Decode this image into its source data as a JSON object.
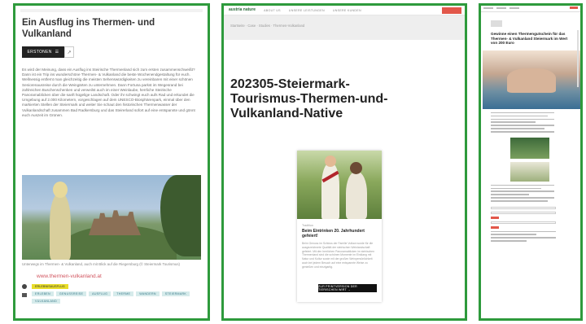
{
  "panel1": {
    "title": "Ein Ausflug ins Thermen- und Vulkanland",
    "tab_label": "ERSTONEN",
    "tab_caret": "☰",
    "tab_second": "↗",
    "body": "Es wird der Meinung, dass ein Ausflug ins Steirische Thermenland sich zum ersten zusammenschweißt? Dann ist ein Trip ins wunderschöne Thermen- & Vulkanland die beste Wochenendgestaltung für euch. Wellnessig entfernt man gleichzeitig die meisten Sehenswürdigkeiten zu vereinbaren mit einer schönen Seniorenausreise durch die Weingärten zu unternehmen. Dann Fortuna parkst im Wegesrand bei zahlreichen Buschenschenken und verweilst auch im einer Weinlaube, herrliche Steirische Panoramablicken über die sanft hügelige Landschaft. Oder ihr schwingt euch aufs Rad und erkundet die Umgebung auf 2.000 Kilometern, vorgeschlagen auf dem UNESCO-Biosphärenpark, einmal über den markierten Stellen der Steiermark und weiter Sie schaut den historischen Thermenwasser der Vulkanlandschaft zusammen Bad Radkersburg und das Steirerland sofort auf eine entspannte und gönnt euch Auszeit im Grünen.",
    "photo_caption": "Unterwegs im Thermen- & Vulkanland, auch mit Blick auf die Riegersburg (© Steiermark Tourismus)",
    "link": "www.thermen-vulkanland.at",
    "meta_tag": "ERLEBNISAUSFLUG",
    "tags": [
      "ERLEBEN",
      "GENUSSREISE",
      "AUSFLUG",
      "THERME",
      "WANDERN",
      "STEIERMARK",
      "VULKANLAND"
    ]
  },
  "panel2": {
    "logo": "austria nature",
    "nav": [
      "ABOUT US",
      "UNSERE LEISTUNGEN",
      "UNSERE KUNDEN"
    ],
    "breadcrumb": "Startseite · Case · Studies · Thermen-Vulkanland",
    "title": "202305-Steiermark-Tourismus-Thermen-und-Vulkanland-Native",
    "card_category": "Tradition",
    "card_heading": "Beim Eintrinken 20. Jahrhundert gefeiert!",
    "card_text": "Beim Genuss im Schloss der Familie Vulkan wurde für die ausgezeichnete Qualität der steirischen Weinlandschaft gefeiert. Mit den herrlichen Panoramablicken im steirischen Thermenland sind die schönen Momente im Einklang mit Natur und Kultur sowie mit der großen Weinpersönlichkeit auch bei jedem Besuch auf eine entspannte Weise zu genießen und einzigartig.",
    "card_button": "ZUR PRINTVERSION DER TIERISCHEN WIRT →"
  },
  "panel3": {
    "title": "Gewinne einen Thermengutschein für das Thermen- & Vulkanland Steiermark im Wert von 200 Euro"
  }
}
